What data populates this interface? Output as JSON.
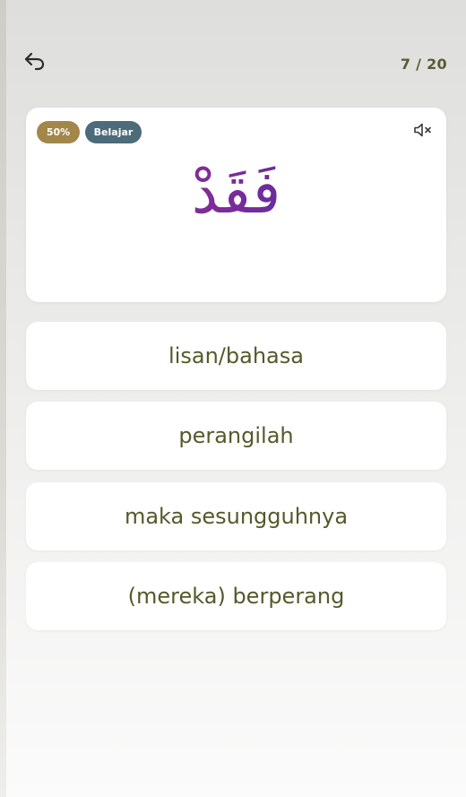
{
  "header": {
    "back_icon": "back-arrow-icon",
    "counter": "7 / 20"
  },
  "card": {
    "progress_badge": "50%",
    "mode_badge": "Belajar",
    "mute_icon": "speaker-muted-icon",
    "arabic_word": "فَقَدْ",
    "colors": {
      "progress_badge": "#a2874b",
      "mode_badge": "#4d6b7a",
      "word_gradient_start": "#9b2f8f",
      "word_gradient_end": "#2a2fa8"
    }
  },
  "options": [
    {
      "label": "lisan/bahasa"
    },
    {
      "label": "perangilah"
    },
    {
      "label": "maka sesungguhnya"
    },
    {
      "label": "(mereka) berperang"
    }
  ],
  "theme": {
    "option_text": "#545a2a",
    "counter_text": "#5a5a36"
  }
}
